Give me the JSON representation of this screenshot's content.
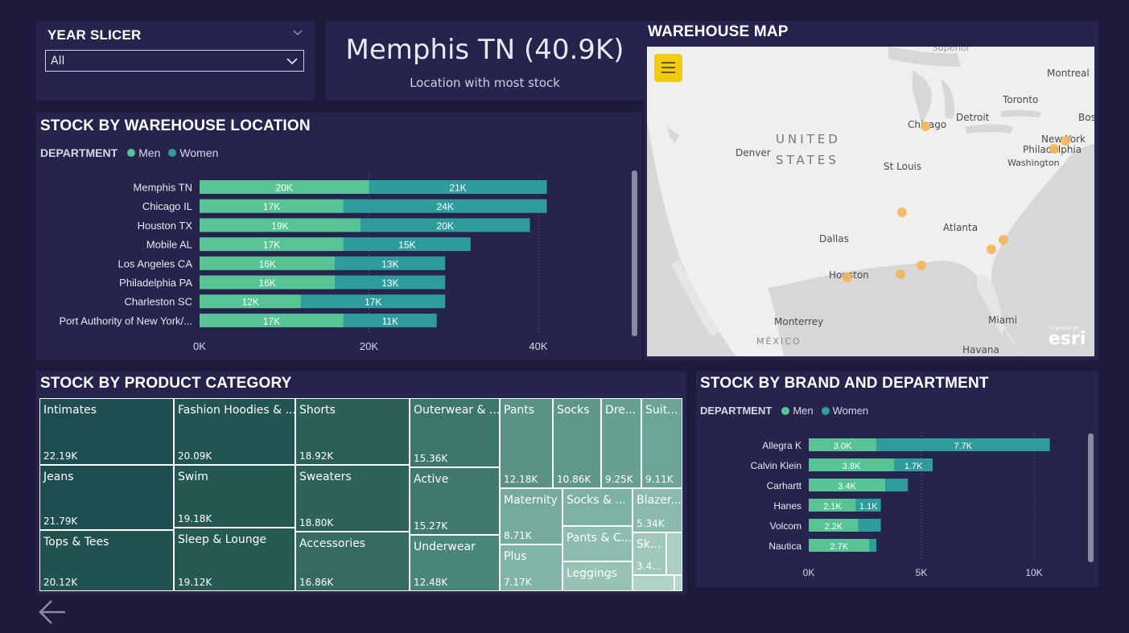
{
  "slicer": {
    "title": "YEAR SLICER",
    "value": "All"
  },
  "kpi": {
    "value": "Memphis TN (40.9K)",
    "label": "Location with most stock"
  },
  "warehouse_chart": {
    "title": "STOCK BY WAREHOUSE LOCATION",
    "legend_title": "DEPARTMENT",
    "legend": [
      "Men",
      "Women"
    ]
  },
  "map": {
    "title": "WAREHOUSE MAP",
    "labels": [
      "Montreal",
      "Toronto",
      "Bos",
      "Chicago",
      "Detroit",
      "New York",
      "Philadelphia",
      "Washington",
      "Denver",
      "St Louis",
      "Dallas",
      "Atlanta",
      "Houston",
      "Monterrey",
      "Miami",
      "Havana",
      "Superior"
    ],
    "country_us_line1": "UNITED",
    "country_us_line2": "STATES",
    "country_mx": "MÉXICO",
    "brand_small": "POWERED BY",
    "brand": "esri"
  },
  "category_chart": {
    "title": "STOCK BY PRODUCT CATEGORY",
    "cells": [
      {
        "label": "Intimates",
        "value": "22.19K"
      },
      {
        "label": "Jeans",
        "value": "21.79K"
      },
      {
        "label": "Tops & Tees",
        "value": "20.12K"
      },
      {
        "label": "Fashion Hoodies & ...",
        "value": "20.09K"
      },
      {
        "label": "Swim",
        "value": "19.18K"
      },
      {
        "label": "Sleep & Lounge",
        "value": "19.12K"
      },
      {
        "label": "Shorts",
        "value": "18.92K"
      },
      {
        "label": "Sweaters",
        "value": "18.80K"
      },
      {
        "label": "Accessories",
        "value": "16.86K"
      },
      {
        "label": "Outerwear & ...",
        "value": "15.36K"
      },
      {
        "label": "Active",
        "value": "15.27K"
      },
      {
        "label": "Underwear",
        "value": "12.48K"
      },
      {
        "label": "Pants",
        "value": "12.18K"
      },
      {
        "label": "Socks",
        "value": "10.86K"
      },
      {
        "label": "Dre...",
        "value": "9.25K"
      },
      {
        "label": "Suit...",
        "value": "9.11K"
      },
      {
        "label": "Maternity",
        "value": "8.71K"
      },
      {
        "label": "Plus",
        "value": "7.17K"
      },
      {
        "label": "Socks & ...",
        "value": ""
      },
      {
        "label": "Blazer...",
        "value": "5.34K"
      },
      {
        "label": "Pants & C...",
        "value": ""
      },
      {
        "label": "Sk...",
        "value": "3.4..."
      },
      {
        "label": "Leggings",
        "value": ""
      }
    ]
  },
  "brand_chart": {
    "title": "STOCK BY BRAND AND DEPARTMENT",
    "legend_title": "DEPARTMENT",
    "legend": [
      "Men",
      "Women"
    ]
  },
  "colors": {
    "men": "#58c495",
    "women": "#2f9c9c",
    "bg": "#1d1a3b",
    "panel": "#26234d",
    "map_dot": "#f5b558",
    "menu_button": "#f2cc0c"
  },
  "chart_data": [
    {
      "type": "bar",
      "orientation": "horizontal",
      "stacked": true,
      "title": "STOCK BY WAREHOUSE LOCATION",
      "categories": [
        "Memphis TN",
        "Chicago IL",
        "Houston TX",
        "Mobile AL",
        "Los Angeles CA",
        "Philadelphia PA",
        "Charleston SC",
        "Port Authority of New York/..."
      ],
      "series": [
        {
          "name": "Men",
          "values": [
            20,
            17,
            19,
            17,
            16,
            16,
            12,
            17
          ],
          "labels": [
            "20K",
            "17K",
            "19K",
            "17K",
            "16K",
            "16K",
            "12K",
            "17K"
          ]
        },
        {
          "name": "Women",
          "values": [
            21,
            24,
            20,
            15,
            13,
            13,
            17,
            11
          ],
          "labels": [
            "21K",
            "24K",
            "20K",
            "15K",
            "13K",
            "13K",
            "17K",
            "11K"
          ]
        }
      ],
      "xlim": [
        0,
        40
      ],
      "xticks": [
        "0K",
        "20K",
        "40K"
      ],
      "unit": "K",
      "legend_title": "DEPARTMENT",
      "grid": true
    },
    {
      "type": "bar",
      "orientation": "horizontal",
      "stacked": true,
      "title": "STOCK BY BRAND AND DEPARTMENT",
      "categories": [
        "Allegra K",
        "Calvin Klein",
        "Carhartt",
        "Hanes",
        "Volcom",
        "Nautica"
      ],
      "series": [
        {
          "name": "Men",
          "values": [
            3.0,
            3.8,
            3.4,
            2.1,
            2.2,
            2.7
          ],
          "labels": [
            "3.0K",
            "3.8K",
            "3.4K",
            "2.1K",
            "2.2K",
            "2.7K"
          ]
        },
        {
          "name": "Women",
          "values": [
            7.7,
            1.7,
            1.0,
            1.1,
            1.0,
            0.3
          ],
          "labels": [
            "7.7K",
            "1.7K",
            "",
            "1.1K",
            "",
            ""
          ]
        }
      ],
      "xlim": [
        0,
        10
      ],
      "xticks": [
        "0K",
        "5K",
        "10K"
      ],
      "unit": "K",
      "legend_title": "DEPARTMENT",
      "grid": true
    },
    {
      "type": "treemap",
      "title": "STOCK BY PRODUCT CATEGORY",
      "categories": [
        "Intimates",
        "Jeans",
        "Tops & Tees",
        "Fashion Hoodies & Sweatshirts",
        "Swim",
        "Sleep & Lounge",
        "Shorts",
        "Sweaters",
        "Accessories",
        "Outerwear & Coats",
        "Active",
        "Underwear",
        "Pants",
        "Socks",
        "Dresses",
        "Suits",
        "Maternity",
        "Plus",
        "Blazers",
        "Skirts"
      ],
      "values": [
        22.19,
        21.79,
        20.12,
        20.09,
        19.18,
        19.12,
        18.92,
        18.8,
        16.86,
        15.36,
        15.27,
        12.48,
        12.18,
        10.86,
        9.25,
        9.11,
        8.71,
        7.17,
        5.34,
        3.4
      ],
      "unit": "K"
    }
  ]
}
